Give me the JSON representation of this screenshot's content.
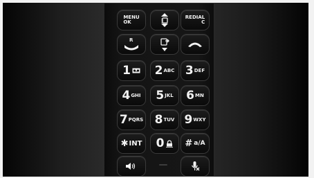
{
  "keypad": {
    "menu": {
      "line1": "MENU",
      "line2": "OK"
    },
    "redial": {
      "line1": "REDIAL",
      "line2": "C"
    },
    "r_label": "R",
    "digits": [
      {
        "digit": "1",
        "letters": ""
      },
      {
        "digit": "2",
        "letters": "ABC"
      },
      {
        "digit": "3",
        "letters": "DEF"
      },
      {
        "digit": "4",
        "letters": "GHI"
      },
      {
        "digit": "5",
        "letters": "JKL"
      },
      {
        "digit": "6",
        "letters": "MN"
      },
      {
        "digit": "7",
        "letters": "PQRS"
      },
      {
        "digit": "8",
        "letters": "TUV"
      },
      {
        "digit": "9",
        "letters": "WXY"
      }
    ],
    "star": {
      "symbol": "✱",
      "label": "INT"
    },
    "zero": {
      "digit": "0"
    },
    "hash": {
      "symbol": "#",
      "label": "a/A"
    }
  },
  "colors": {
    "key_face": "#111111",
    "key_text": "#f2f2f2",
    "housing": "#151515"
  }
}
